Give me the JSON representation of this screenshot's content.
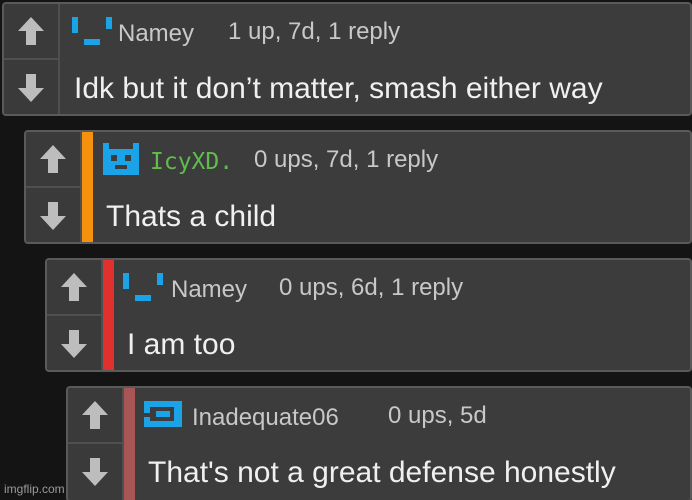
{
  "colors": {
    "accent_blue": "#1aa3e6",
    "accent_green": "#5fbd4a",
    "depth_orange": "#f5910d",
    "depth_red": "#e0312e",
    "depth_rose": "#a85555"
  },
  "icons": {
    "upvote": "up-arrow-icon",
    "downvote": "down-arrow-icon",
    "avatar": "pixel-avatar-icon"
  },
  "comments": [
    {
      "username": "Namey",
      "meta": "1 up, 7d, 1 reply",
      "text": "Idk but it don’t matter, smash either way"
    },
    {
      "username": "IcyXD.",
      "meta": "0 ups, 7d, 1 reply",
      "text": "Thats a child"
    },
    {
      "username": "Namey",
      "meta": "0 ups, 6d, 1 reply",
      "text": "I am too"
    },
    {
      "username": "Inadequate06",
      "meta": "0 ups, 5d",
      "text": "That's not a great defense honestly"
    }
  ],
  "watermark": "imgflip.com"
}
